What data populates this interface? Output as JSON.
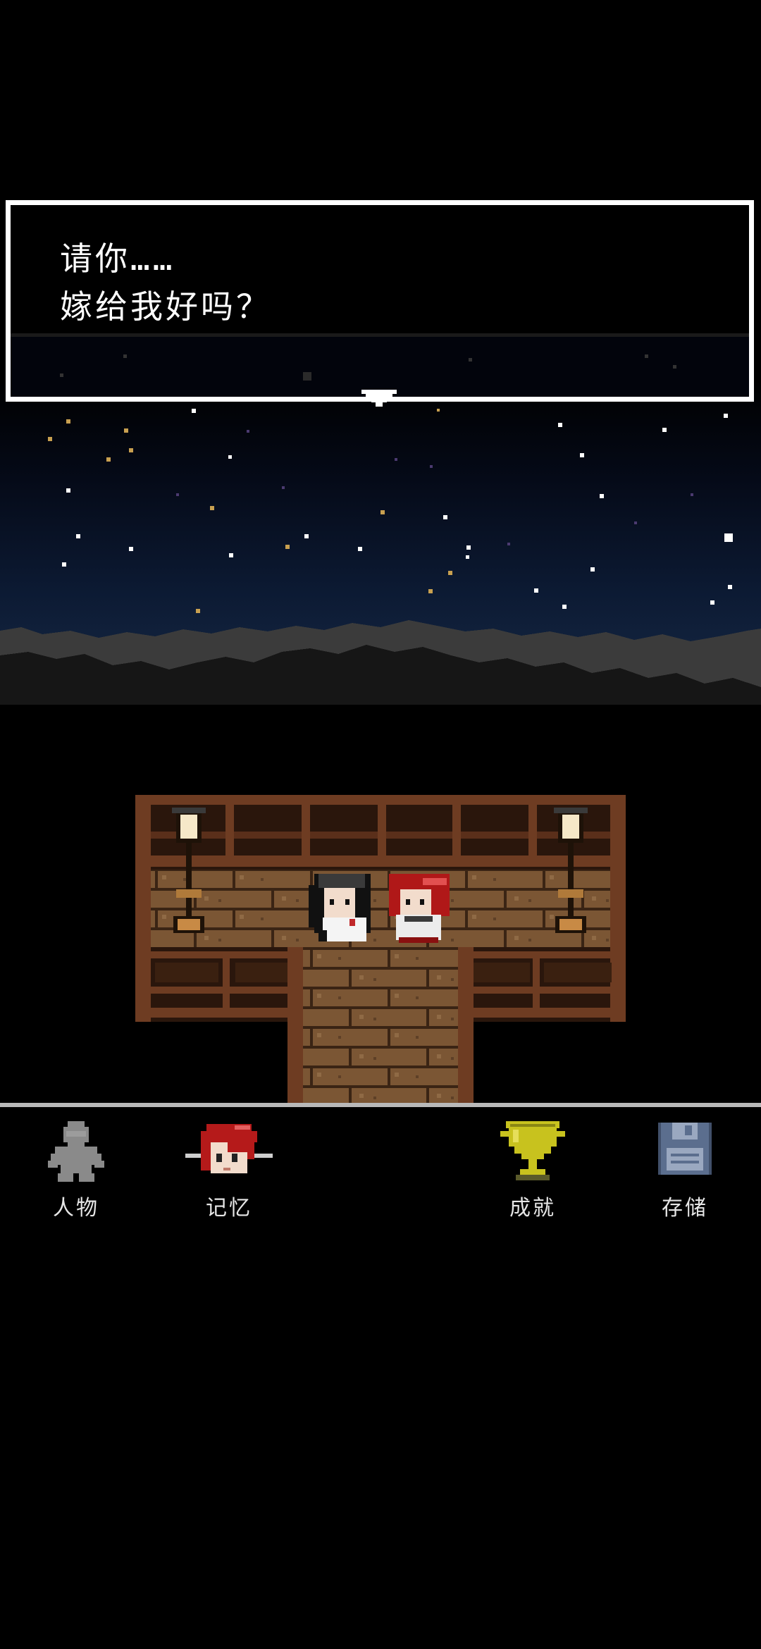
{
  "dialog": {
    "line1": "请你……",
    "line2": "嫁给我好吗？"
  },
  "scene": {
    "description_colors": {
      "sky": "#0b1830",
      "mountains_far": "#3a3a3a",
      "mountains_near": "#151515",
      "deck_wood": "#6b3b22",
      "deck_floor": "#7a5a3a"
    },
    "characters": [
      "black-haired-girl",
      "red-haired-boy"
    ]
  },
  "menu": {
    "people": {
      "label": "人物",
      "icon": "person-silhouette-icon"
    },
    "memory": {
      "label": "记忆",
      "icon": "red-haired-face-icon"
    },
    "achievements": {
      "label": "成就",
      "icon": "trophy-icon"
    },
    "save": {
      "label": "存储",
      "icon": "floppy-disk-icon"
    }
  },
  "colors": {
    "menu_label": "#e6e6e6",
    "divider": "#b9b9b9",
    "trophy": "#c8c21e",
    "floppy": "#5b6e8e"
  }
}
